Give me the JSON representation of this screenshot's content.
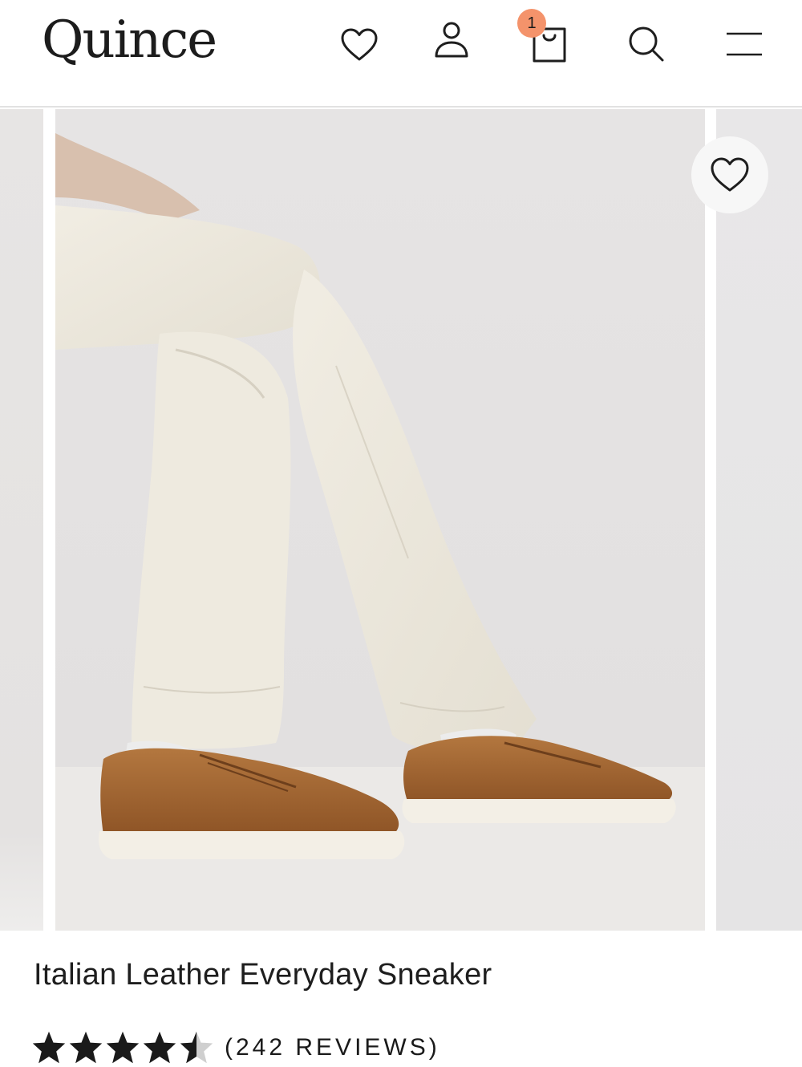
{
  "header": {
    "logo": "Quince",
    "icons": [
      "heart-icon",
      "account-icon",
      "shopping-bag-icon",
      "search-icon",
      "menu-icon"
    ],
    "bag_count": "1",
    "badge_color": "#f4936b"
  },
  "gallery": {
    "favorite_icon": "heart-icon"
  },
  "product": {
    "title": "Italian Leather Everyday Sneaker",
    "rating": 4.5,
    "rating_max": 5,
    "reviews_text": "(242 REVIEWS)"
  }
}
